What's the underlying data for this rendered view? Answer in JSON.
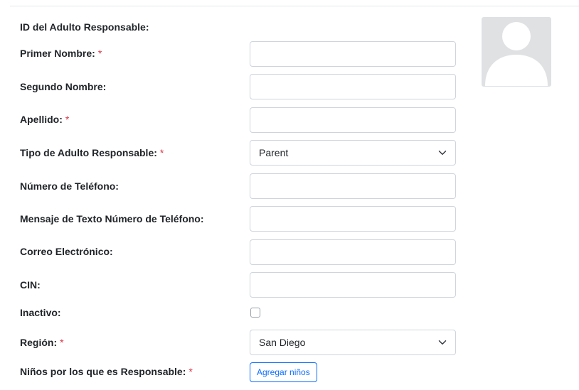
{
  "form": {
    "id_label": "ID del Adulto Responsable:",
    "required_mark": "*",
    "first_name": {
      "label": "Primer Nombre:",
      "value": ""
    },
    "middle_name": {
      "label": "Segundo Nombre:",
      "value": ""
    },
    "last_name": {
      "label": "Apellido:",
      "value": ""
    },
    "guardian_type": {
      "label": "Tipo de Adulto Responsable:",
      "value": "Parent"
    },
    "phone": {
      "label": "Número de Teléfono:",
      "value": ""
    },
    "sms_phone": {
      "label": "Mensaje de Texto Número de Teléfono:",
      "value": ""
    },
    "email": {
      "label": "Correo Electrónico:",
      "value": ""
    },
    "cin": {
      "label": "CIN:",
      "value": ""
    },
    "inactive": {
      "label": "Inactivo:",
      "checked": false
    },
    "region": {
      "label": "Región:",
      "value": "San Diego"
    },
    "children": {
      "label": "Niños por los que es Responsable:",
      "button_label": "Agregar niños"
    }
  },
  "avatar": {
    "icon": "person-placeholder-icon"
  },
  "colors": {
    "required": "#dc3545",
    "primary": "#0d6efd",
    "border": "#ced4da"
  }
}
